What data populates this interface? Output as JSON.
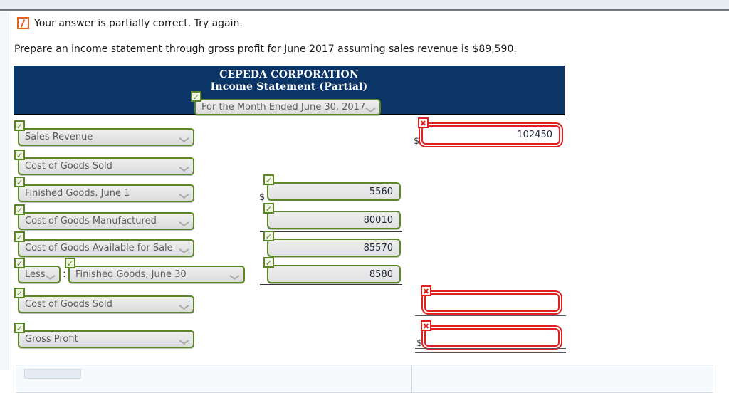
{
  "feedback": {
    "icon": "partial-correct-icon",
    "text": "Your answer is partially correct.  Try again."
  },
  "instruction": "Prepare an income statement through gross profit for June 2017 assuming sales revenue is $89,590.",
  "statement": {
    "company": "CEPEDA CORPORATION",
    "title": "Income Statement (Partial)",
    "period_select": {
      "value": "For the Month Ended June 30, 2017",
      "status": "correct"
    }
  },
  "badges": {
    "correct": "✓",
    "incorrect": "✖"
  },
  "symbols": {
    "dollar": "$",
    "colon": ":"
  },
  "rows": [
    {
      "label": "Sales Revenue",
      "label_status": "correct",
      "amount": "102450",
      "amount_status": "incorrect",
      "amount_column": "right",
      "dollar": true
    },
    {
      "label": "Cost of Goods Sold",
      "label_status": "correct",
      "amount": "",
      "amount_status": "none",
      "amount_column": "none",
      "dollar": false
    },
    {
      "label": "Finished Goods, June 1",
      "label_status": "correct",
      "amount": "5560",
      "amount_status": "correct",
      "amount_column": "middle",
      "dollar": true
    },
    {
      "label": "Cost of Goods Manufactured",
      "label_status": "correct",
      "amount": "80010",
      "amount_status": "correct",
      "amount_column": "middle",
      "dollar": false
    },
    {
      "label": "Cost of Goods Available for Sale",
      "label_status": "correct",
      "amount": "85570",
      "amount_status": "correct",
      "amount_column": "middle",
      "dollar": false
    },
    {
      "label": "Finished Goods, June 30",
      "label_status": "correct",
      "prefix_label": "Less",
      "prefix_status": "correct",
      "amount": "8580",
      "amount_status": "correct",
      "amount_column": "middle",
      "dollar": false
    },
    {
      "label": "Cost of Goods Sold",
      "label_status": "correct",
      "amount": "",
      "amount_status": "incorrect",
      "amount_column": "right",
      "dollar": false
    },
    {
      "label": "Gross Profit",
      "label_status": "correct",
      "amount": "",
      "amount_status": "incorrect",
      "amount_column": "right",
      "dollar": true
    }
  ]
}
